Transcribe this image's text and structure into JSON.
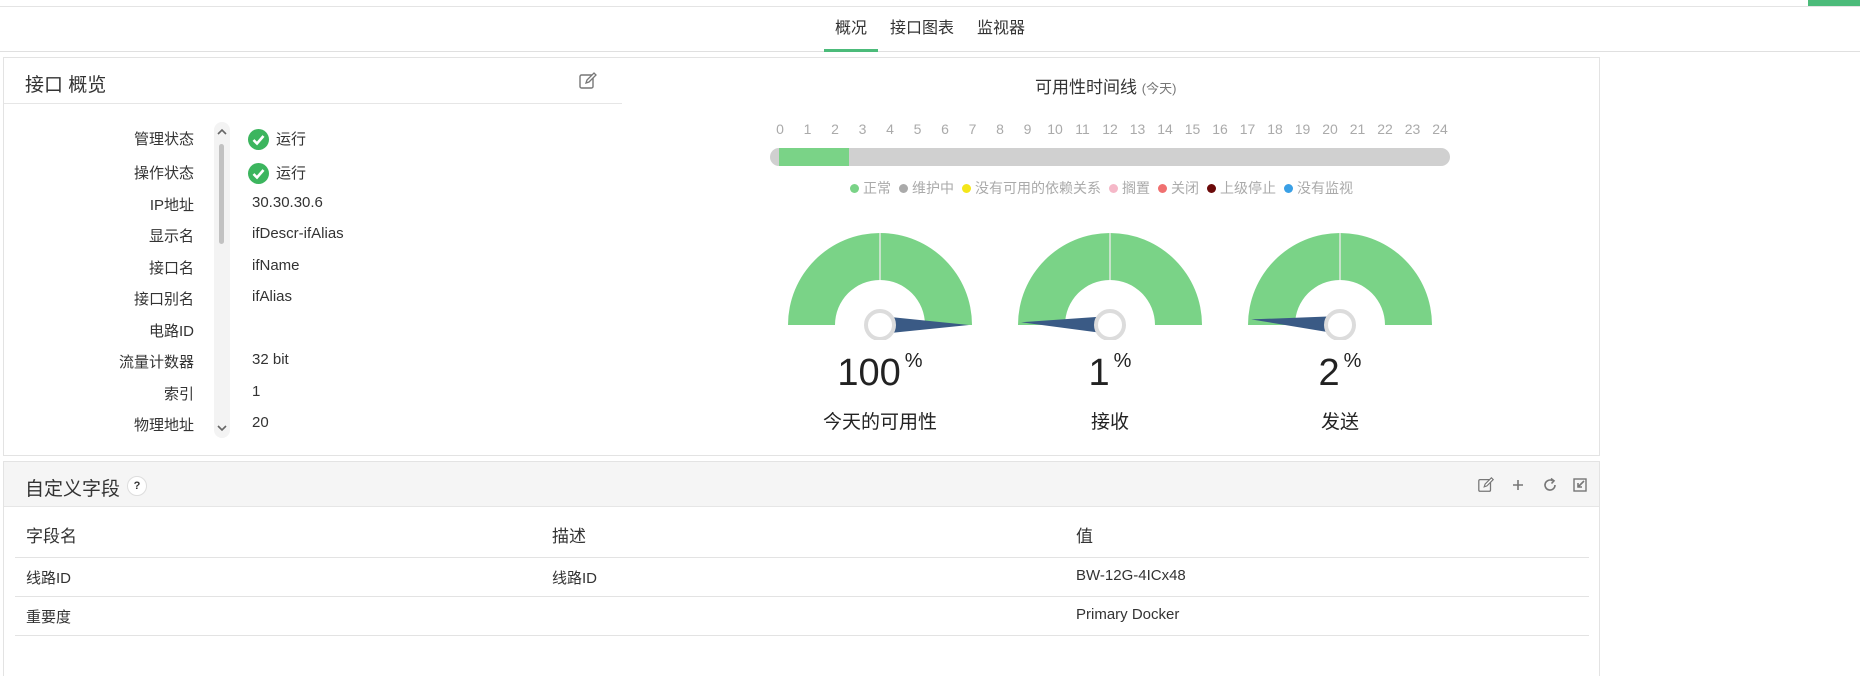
{
  "tabs": [
    {
      "label": "概况",
      "active": true
    },
    {
      "label": "接口图表",
      "active": false
    },
    {
      "label": "监视器",
      "active": false
    }
  ],
  "overview": {
    "title": "接口 概览",
    "properties": [
      {
        "label": "管理状态",
        "value": "运行",
        "status": "ok"
      },
      {
        "label": "操作状态",
        "value": "运行",
        "status": "ok"
      },
      {
        "label": "IP地址",
        "value": "30.30.30.6"
      },
      {
        "label": "显示名",
        "value": "ifDescr-ifAlias"
      },
      {
        "label": "接口名",
        "value": "ifName"
      },
      {
        "label": "接口别名",
        "value": "ifAlias"
      },
      {
        "label": "电路ID",
        "value": ""
      },
      {
        "label": "流量计数器",
        "value": "32 bit"
      },
      {
        "label": "索引",
        "value": "1"
      },
      {
        "label": "物理地址",
        "value": "20"
      }
    ]
  },
  "availability": {
    "title": "可用性时间线",
    "subtitle": "(今天)",
    "hours": [
      "0",
      "1",
      "2",
      "3",
      "4",
      "5",
      "6",
      "7",
      "8",
      "9",
      "10",
      "11",
      "12",
      "13",
      "14",
      "15",
      "16",
      "17",
      "18",
      "19",
      "20",
      "21",
      "22",
      "23",
      "24"
    ],
    "up_fraction": 0.105,
    "legend": [
      {
        "label": "正常",
        "color": "#7ad387"
      },
      {
        "label": "维护中",
        "color": "#aaaaaa"
      },
      {
        "label": "没有可用的依赖关系",
        "color": "#f4e61a"
      },
      {
        "label": "搁置",
        "color": "#f5b8c8"
      },
      {
        "label": "关闭",
        "color": "#f07070"
      },
      {
        "label": "上级停止",
        "color": "#6b0a0a"
      },
      {
        "label": "没有监视",
        "color": "#3aa0e6"
      }
    ],
    "gauge_color": "#7ad387",
    "needle_color": "#3a5a85",
    "gauges": [
      {
        "value": "100",
        "unit": "%",
        "label": "今天的可用性",
        "percent": 100
      },
      {
        "value": "1",
        "unit": "%",
        "label": "接收",
        "percent": 1
      },
      {
        "value": "2",
        "unit": "%",
        "label": "发送",
        "percent": 2
      }
    ]
  },
  "custom_fields": {
    "title": "自定义字段",
    "help": "?",
    "headers": {
      "name": "字段名",
      "desc": "描述",
      "value": "值"
    },
    "rows": [
      {
        "name": "线路ID",
        "desc": "线路ID",
        "value": "BW-12G-4ICx48"
      },
      {
        "name": "重要度",
        "desc": "",
        "value": "Primary Docker"
      }
    ]
  }
}
